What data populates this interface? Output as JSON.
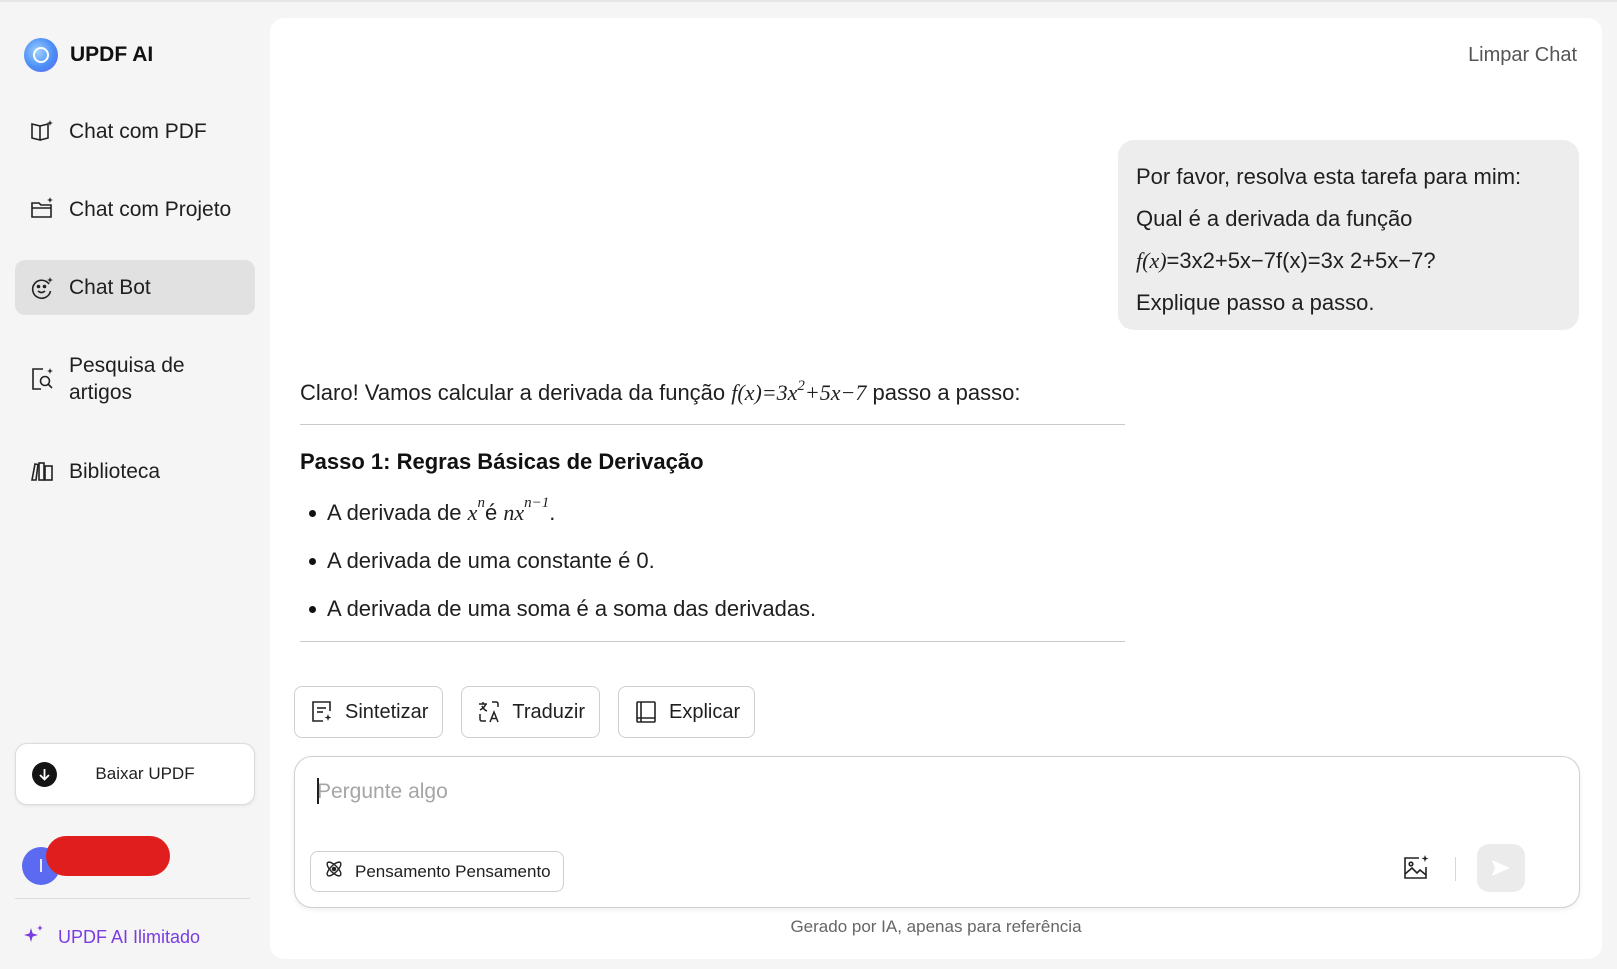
{
  "app": {
    "brand": "UPDF AI"
  },
  "sidebar": {
    "items": [
      {
        "label": "Chat com PDF",
        "icon": "book-sparkle-icon",
        "active": false
      },
      {
        "label": "Chat com Projeto",
        "icon": "folder-sparkle-icon",
        "active": false
      },
      {
        "label": "Chat Bot",
        "icon": "bot-face-icon",
        "active": true
      },
      {
        "label": "Pesquisa de artigos",
        "icon": "search-document-icon",
        "active": false
      },
      {
        "label": "Biblioteca",
        "icon": "library-icon",
        "active": false
      }
    ],
    "download_label": "Baixar UPDF",
    "avatar_initial": "I",
    "unlimited_label": "UPDF AI Ilimitado"
  },
  "header": {
    "clear_label": "Limpar Chat"
  },
  "user_message": {
    "line1": "Por favor, resolva esta tarefa para mim:",
    "line2": "Qual é a derivada da função",
    "line3_math": "f(x)",
    "line3_rest": "=3x2+5x−7f(x)=3x 2+5x−7?",
    "line4": "Explique passo a passo."
  },
  "answer": {
    "intro_pre": "Claro! Vamos calcular a derivada da função ",
    "intro_math_a": "f(x)=3x",
    "intro_math_sup": "2",
    "intro_math_b": "+5x−7",
    "intro_post": " passo a passo:",
    "step_title": "Passo 1: Regras Básicas de Derivação",
    "bullet1_pre": "A derivada de ",
    "bullet1_x": "x",
    "bullet1_n": "n",
    "bullet1_mid": " é ",
    "bullet1_nx": "nx",
    "bullet1_exp": "n−1",
    "bullet1_end": ".",
    "bullet2": "A derivada de uma constante é 0.",
    "bullet3": "A derivada de uma soma é a soma das derivadas."
  },
  "actions": [
    {
      "label": "Sintetizar",
      "icon": "summarize-icon"
    },
    {
      "label": "Traduzir",
      "icon": "translate-icon"
    },
    {
      "label": "Explicar",
      "icon": "book-icon"
    }
  ],
  "composer": {
    "placeholder": "Pergunte algo",
    "think_label": "Pensamento Pensamento",
    "footnote": "Gerado por IA, apenas para referência"
  },
  "colors": {
    "accent": "#7a3de0",
    "active_nav": "#e1e1e1",
    "avatar": "#5b6af0"
  }
}
